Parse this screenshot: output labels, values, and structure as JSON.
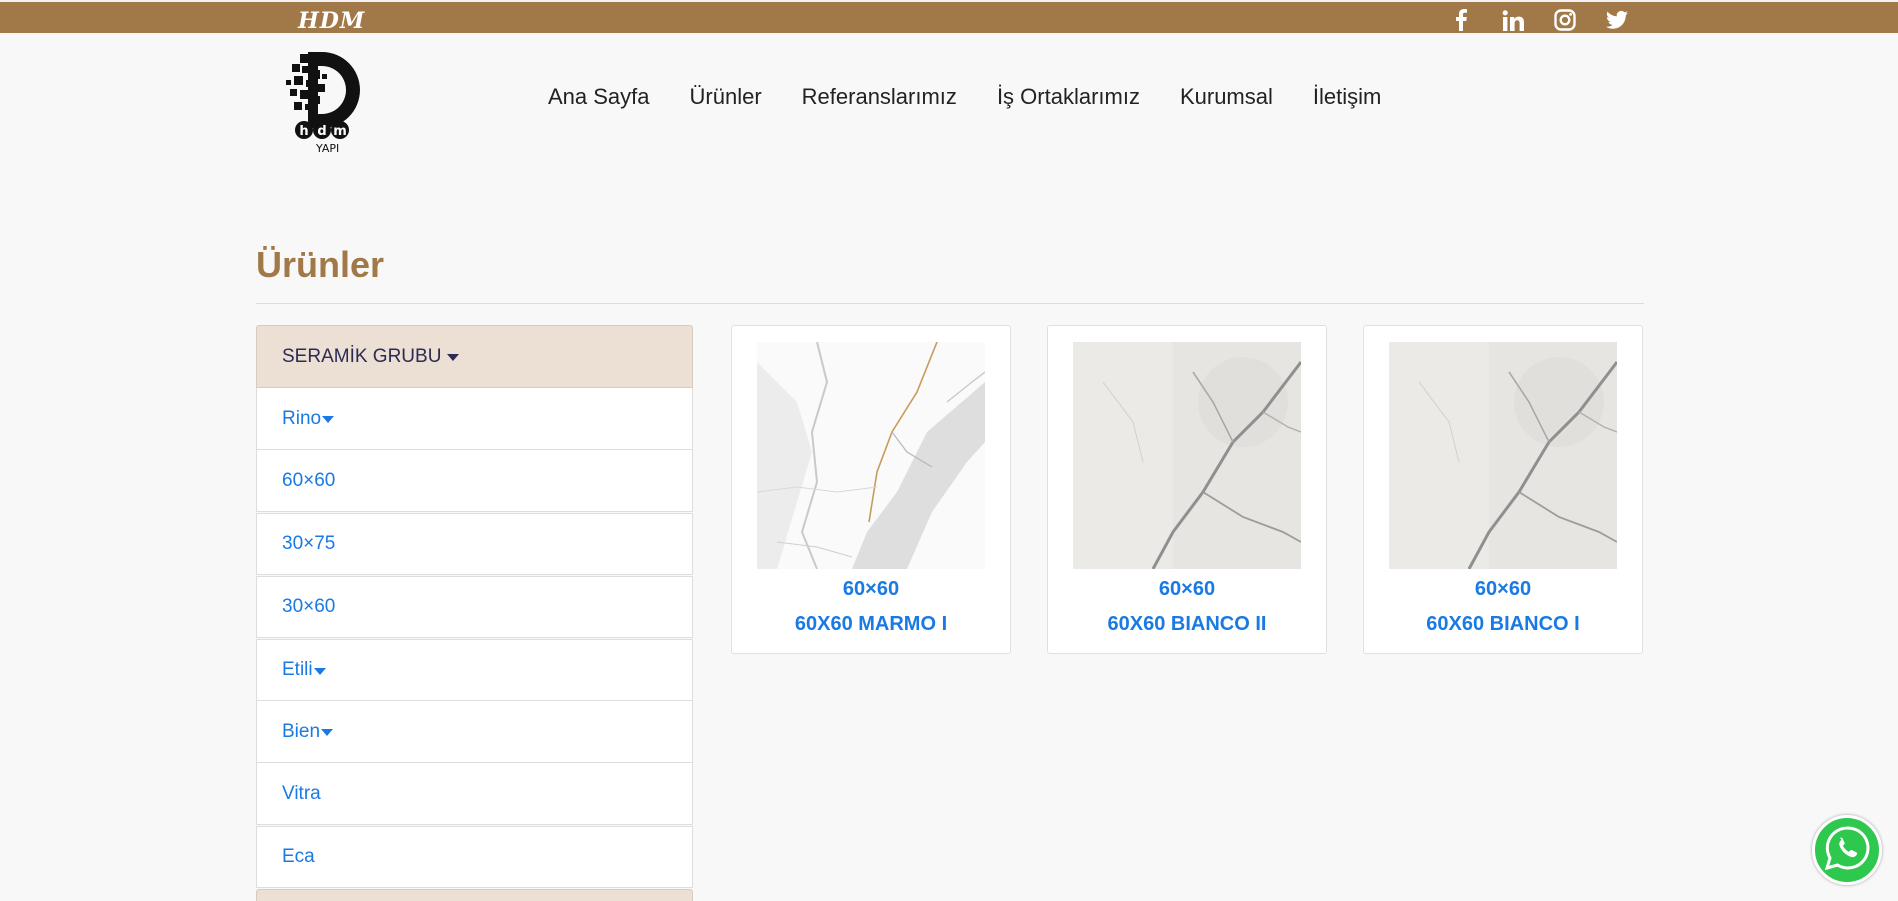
{
  "topbar": {
    "brand": "HDM",
    "socials": [
      "facebook-icon",
      "linkedin-icon",
      "instagram-icon",
      "twitter-icon"
    ]
  },
  "logo": {
    "caption": "YAPI",
    "mark": "hdm"
  },
  "nav": {
    "items": [
      "Ana Sayfa",
      "Ürünler",
      "Referanslarımız",
      "İş Ortaklarımız",
      "Kurumsal",
      "İletişim"
    ]
  },
  "page": {
    "title": "Ürünler"
  },
  "sidebar": {
    "group": "SERAMİK GRUBU",
    "items": [
      {
        "label": "Rino",
        "dropdown": true
      },
      {
        "label": "60×60",
        "dropdown": false
      },
      {
        "label": "30×75",
        "dropdown": false
      },
      {
        "label": "30×60",
        "dropdown": false
      },
      {
        "label": "Etili",
        "dropdown": true
      },
      {
        "label": "Bien",
        "dropdown": true
      },
      {
        "label": "Vitra",
        "dropdown": false
      },
      {
        "label": "Eca",
        "dropdown": false
      }
    ]
  },
  "products": [
    {
      "size": "60×60",
      "name": "60X60 MARMO I"
    },
    {
      "size": "60×60",
      "name": "60X60 BIANCO II"
    },
    {
      "size": "60×60",
      "name": "60X60 BIANCO I"
    }
  ],
  "colors": {
    "topbar": "#a17848",
    "title": "#a17848",
    "link": "#1a7ae3",
    "group_bg": "#ecdfd3",
    "whatsapp": "#2fc84f"
  }
}
